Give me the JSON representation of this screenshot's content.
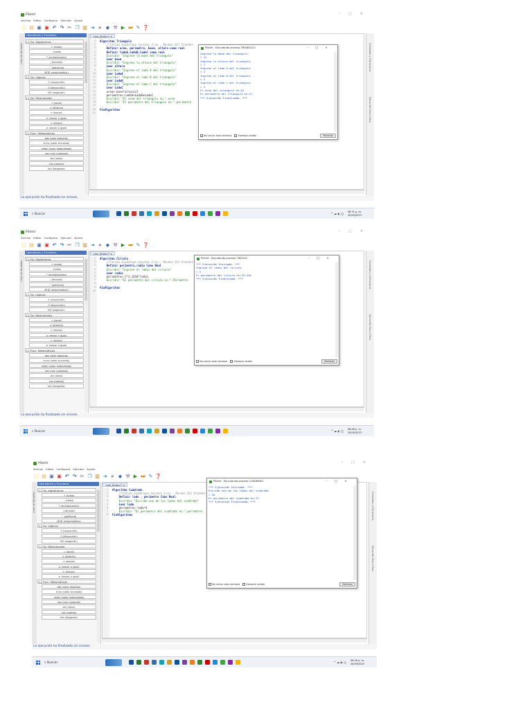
{
  "shots": [
    {
      "app_title": "PSeInt",
      "menu": [
        "Archivo",
        "Editar",
        "Configurar",
        "Ejecutar",
        "Ayuda"
      ],
      "panel_title": "Operadores y Funciones",
      "left_tab": "Lista de Variables",
      "editor_tab": "<sin_titulo>*  ×",
      "gutter": [
        "1",
        "2",
        "3",
        "4",
        "5",
        "6",
        "7",
        "8",
        "9",
        "10",
        "11",
        "12",
        "13",
        "14",
        "15",
        "16",
        "17",
        "18",
        "19",
        "20",
        "21"
      ],
      "code": [
        {
          "t": "Algoritmo Triangulo",
          "c": "kw"
        },
        {
          "t": "    //Fatima Guadalupe Sanchez Cruz - Mendez DIJ Ordoñez",
          "c": "cm"
        },
        {
          "t": "    Definir area, perimetro, base, altura como real",
          "c": "kw"
        },
        {
          "t": "    Definir ladoA,ladoB,ladoC como real",
          "c": "kw"
        },
        {
          "t": "    Escribir \"Ingrese la base del triangulo\"",
          "c": "str"
        },
        {
          "t": "    Leer base",
          "c": "kw"
        },
        {
          "t": "    Escribir \"Ingrese la altura del triangulo\"",
          "c": "str"
        },
        {
          "t": "    Leer altura",
          "c": "kw"
        },
        {
          "t": "    Escribir \"Ingrese el lado A del triangulo\"",
          "c": "str"
        },
        {
          "t": "    Leer LadoA",
          "c": "kw"
        },
        {
          "t": "    Escribir \"Ingrese el lado B del triangulo\"",
          "c": "str"
        },
        {
          "t": "    Leer LadoB",
          "c": "kw"
        },
        {
          "t": "    Escribir \"Ingrese el lado C del triangulo\"",
          "c": "str"
        },
        {
          "t": "    Leer LadoC",
          "c": "kw"
        },
        {
          "t": "    area<-base*altura/2",
          "c": ""
        },
        {
          "t": "    perimetro<-LadoA+LadoB+LadoC",
          "c": ""
        },
        {
          "t": "    Escribir \"El area del triangulo es:\",area",
          "c": "str"
        },
        {
          "t": "    Escribir \"El perimetro del triangulo es:\",perimetro",
          "c": "str"
        },
        {
          "t": "",
          "c": ""
        },
        {
          "t": "FinAlgoritmo",
          "c": "kw"
        },
        {
          "t": "",
          "c": ""
        }
      ],
      "run_title": "PSeInt - Ejecutando proceso TRIANGULO",
      "run_lines": [
        "Ingrese la base del triangulo",
        "> 12",
        "Ingrese la altura del triangulo",
        "> 7",
        "Ingrese el lado A del triangulo",
        "> 4",
        "Ingrese el lado B del triangulo",
        "> 3",
        "Ingrese el lado C del triangulo",
        "> 4",
        "El area del triangulo es:42",
        "El perimetro del triangulo es:11",
        "*** Ejecución Finalizada. ***"
      ],
      "no_close": "No cerrar esta ventana",
      "always_visible": "Siempre visible",
      "restart": "Reiniciar",
      "status": "La ejecución ha finalizado sin errores.",
      "search": "Buscar",
      "time": "08:31 p. m.",
      "date": "30/09/2023"
    },
    {
      "app_title": "PSeInt",
      "menu": [
        "Archivo",
        "Editar",
        "Configurar",
        "Ejecutar",
        "Ayuda"
      ],
      "panel_title": "Operadores y Funciones",
      "left_tab": "Lista de Variables",
      "editor_tab": "<sin_titulo>*  ×",
      "gutter": [
        "1",
        "2",
        "3",
        "4",
        "5",
        "6",
        "7",
        "8",
        "9",
        "10"
      ],
      "code": [
        {
          "t": "Algoritmo Circulo",
          "c": "kw"
        },
        {
          "t": "    //Fatima Guadalupe Sanchez Cruz - Mendez DIJ Ordoñez",
          "c": "cm"
        },
        {
          "t": "    Definir perimetro,radio Como Real",
          "c": "kw"
        },
        {
          "t": "    Escribir \"Ingrese el radio del circulo\"",
          "c": "str"
        },
        {
          "t": "    Leer radio",
          "c": "kw"
        },
        {
          "t": "    perimetro<-2*3.1416*radio",
          "c": ""
        },
        {
          "t": "    Escribir \"El perimetro del circulo es:\",Perimetro",
          "c": "str"
        },
        {
          "t": "",
          "c": ""
        },
        {
          "t": "FinAlgoritmo",
          "c": "kw"
        },
        {
          "t": "",
          "c": ""
        }
      ],
      "run_title": "PSeInt - Ejecutando proceso CIRCULO",
      "run_lines": [
        "*** Ejecución Iniciada. ***",
        "Ingrese el radio del circulo",
        "> 5",
        "El perimetro del circulo es:31.416",
        "*** Ejecución Finalizada. ***"
      ],
      "no_close": "No cerrar esta ventana",
      "always_visible": "Siempre visible",
      "restart": "Reiniciar",
      "status": "La ejecución ha finalizado sin errores.",
      "search": "Buscar",
      "time": "08:48 p. m.",
      "date": "30/09/2023"
    },
    {
      "app_title": "PSeInt",
      "menu": [
        "Archivo",
        "Editar",
        "Configurar",
        "Ejecutar",
        "Ayuda"
      ],
      "panel_title": "Operadores y Funciones",
      "left_tab": "Lista de Variables",
      "editor_tab": "<sin_titulo>*  ×",
      "gutter": [
        "1",
        "2",
        "3",
        "4",
        "5",
        "6",
        "7",
        "8"
      ],
      "code": [
        {
          "t": "Algoritmo Cuadrado",
          "c": "kw"
        },
        {
          "t": "    //Fatima Guadalupe Sanchez Cruz - Mendez DIJ Ordoñez",
          "c": "cm"
        },
        {
          "t": "    Definir lado , perimetro Como Real",
          "c": "kw"
        },
        {
          "t": "    Escribir \"Escribe uno de los lados del cuadrado\"",
          "c": "str"
        },
        {
          "t": "    Leer lado",
          "c": "kw"
        },
        {
          "t": "    perimetro<-lado*4",
          "c": ""
        },
        {
          "t": "    Escribir \"El perimetro del cuadrado es:\",perimetro",
          "c": "str"
        },
        {
          "t": "FinAlgoritmo",
          "c": "kw"
        }
      ],
      "run_title": "PSeInt - Ejecutando proceso CUADRADO",
      "run_lines": [
        "*** Ejecución Iniciada. ***",
        "Escribe uno de los lados del cuadrado",
        "> 18",
        "El perimetro del cuadrado es:72",
        "*** Ejecución Finalizada. ***"
      ],
      "no_close": "No cerrar esta ventana",
      "always_visible": "Siempre visible",
      "restart": "Reiniciar",
      "status": "La ejecución ha finalizado sin errores.",
      "search": "Buscar",
      "time": "09:05 p. m.",
      "date": "30/09/2023"
    }
  ],
  "operators_panel": [
    {
      "section": "[-] Op. Algebraicos",
      "items": [
        "+ (suma)",
        "- (resta)",
        "* (multiplicación)",
        "/ (división)",
        "^ (potencia)",
        "MOD (resto/módulo)"
      ]
    },
    {
      "section": "[-] Op. Lógicos",
      "items": [
        "Y (conjunción)",
        "O (disyunción)",
        "NO (negación)"
      ]
    },
    {
      "section": "[-] Op. Relacionales",
      "items": [
        "= (igual)",
        "≠ (distinto)",
        "< (menor)",
        "≤ (menor o igual)",
        "> (mayor)",
        "≥ (mayor o igual)"
      ]
    },
    {
      "section": "[-] Func. Matemáticas",
      "items": [
        "abs (valor absoluto)",
        "trunc (valor truncado)",
        "redon (valor redondeado)",
        "raiz (raíz cuadrada)",
        "sen (seno)",
        "cos (coseno)",
        "tan (tangente)"
      ]
    }
  ],
  "right_tabs": [
    "Comandos y Estructuras",
    "Ejecución Paso a Paso"
  ],
  "colors": {
    "accent": "#4c74b8",
    "keyword": "#102a8a",
    "output": "#1a4fb0"
  }
}
